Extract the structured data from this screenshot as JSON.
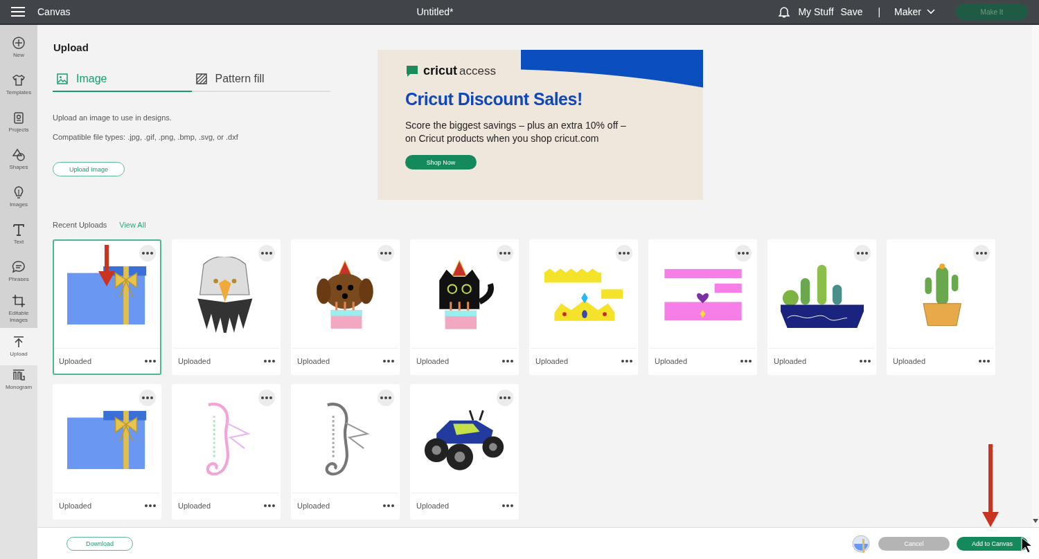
{
  "top_bar": {
    "title": "Canvas",
    "document": "Untitled*",
    "links": [
      "My Stuff",
      "Save"
    ],
    "separator": "|",
    "machine": "Maker",
    "make_button": {
      "label": "Make It",
      "disabled": true
    }
  },
  "sidebar": {
    "items": [
      {
        "label": "New",
        "kind": "plus",
        "selected": false
      },
      {
        "label": "Templates",
        "kind": "shirt",
        "selected": false
      },
      {
        "label": "Projects",
        "kind": "project",
        "selected": false
      },
      {
        "label": "Shapes",
        "kind": "shapes",
        "selected": false
      },
      {
        "label": "Images",
        "kind": "bulb",
        "selected": false
      },
      {
        "label": "Text",
        "kind": "text",
        "selected": false
      },
      {
        "label": "Phrases",
        "kind": "bubble",
        "selected": false
      },
      {
        "label": "Editable Images",
        "kind": "edit",
        "selected": false
      },
      {
        "label": "Upload",
        "kind": "upload",
        "selected": true
      },
      {
        "label": "Monogram",
        "kind": "monogram",
        "selected": false
      }
    ]
  },
  "panel": {
    "title": "Upload",
    "tabs": [
      {
        "label": "Image",
        "kind": "image",
        "selected": true
      },
      {
        "label": "Pattern fill",
        "kind": "pattern",
        "selected": false
      }
    ],
    "description": "Upload an image to use in designs.",
    "file_types": "Compatible file types: .jpg, .gif, .png, .bmp, .svg, or .dxf",
    "upload_button": "Upload Image"
  },
  "banner": {
    "brand": "cricut",
    "brand_suffix": "access",
    "headline": "Cricut Discount Sales!",
    "lines": [
      "Score the biggest savings – plus an extra 10% off –",
      "on Cricut products when you shop cricut.com"
    ],
    "button": "Shop Now"
  },
  "recent": {
    "heading": "Recent Uploads",
    "view_all": "View All",
    "items": [
      {
        "label": "Uploaded",
        "kind": "gift",
        "selected": true
      },
      {
        "label": "Uploaded",
        "kind": "eagle",
        "selected": false
      },
      {
        "label": "Uploaded",
        "kind": "dog",
        "selected": false
      },
      {
        "label": "Uploaded",
        "kind": "cat",
        "selected": false
      },
      {
        "label": "Uploaded",
        "kind": "crown-yellow",
        "selected": false
      },
      {
        "label": "Uploaded",
        "kind": "crown-pink",
        "selected": false
      },
      {
        "label": "Uploaded",
        "kind": "cactus-pot",
        "selected": false
      },
      {
        "label": "Uploaded",
        "kind": "cactus",
        "selected": false
      },
      {
        "label": "Uploaded",
        "kind": "gift",
        "selected": false
      },
      {
        "label": "Uploaded",
        "kind": "seahorse-color",
        "selected": false
      },
      {
        "label": "Uploaded",
        "kind": "seahorse-gray",
        "selected": false
      },
      {
        "label": "Uploaded",
        "kind": "atv",
        "selected": false
      }
    ]
  },
  "footer": {
    "download": "Download",
    "cancel": {
      "label": "Cancel",
      "disabled": true
    },
    "add": "Add to Canvas"
  }
}
